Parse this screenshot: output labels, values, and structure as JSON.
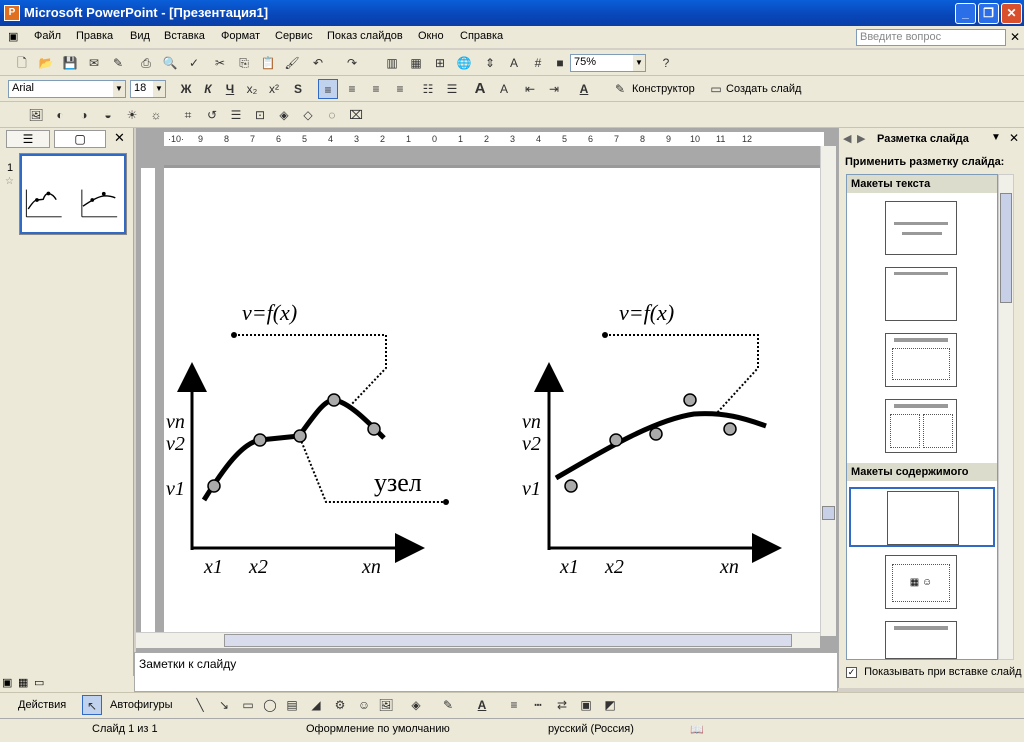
{
  "window": {
    "title": "Microsoft PowerPoint - [Презентация1]",
    "app_icon": "P",
    "min": "_",
    "restore": "❐",
    "close": "✕"
  },
  "menu": {
    "items": [
      "Файл",
      "Правка",
      "Вид",
      "Вставка",
      "Формат",
      "Сервис",
      "Показ слайдов",
      "Окно",
      "Справка"
    ],
    "help_placeholder": "Введите вопрос"
  },
  "toolbar": {
    "zoom": "75%",
    "font": "Arial",
    "size": "18",
    "bold": "Ж",
    "italic": "К",
    "underline": "Ч",
    "designer": "Конструктор",
    "new_slide": "Создать слайд"
  },
  "left_panel": {
    "slide_number": "1",
    "tab_outline": "☰",
    "tab_slides": "▢"
  },
  "notes": {
    "text": "Заметки к слайду"
  },
  "task_pane": {
    "title": "Разметка слайда",
    "apply_label": "Применить разметку слайда:",
    "section_text": "Макеты текста",
    "section_content": "Макеты содержимого",
    "show_checkbox": "Показывать при вставке слайд"
  },
  "slide": {
    "left": {
      "func": "v=f(x)",
      "v_n": "vn",
      "v2": "v2",
      "v1": "v1",
      "x1": "x1",
      "x2": "x2",
      "xn": "xn",
      "node_label": "узел"
    },
    "right": {
      "func": "v=f(x)",
      "v_n": "vn",
      "v2": "v2",
      "v1": "v1",
      "x1": "x1",
      "x2": "x2",
      "xn": "xn"
    }
  },
  "drawing": {
    "actions": "Действия",
    "autoshapes": "Автофигуры"
  },
  "status": {
    "slide": "Слайд 1 из 1",
    "design": "Оформление по умолчанию",
    "lang": "русский (Россия)"
  }
}
